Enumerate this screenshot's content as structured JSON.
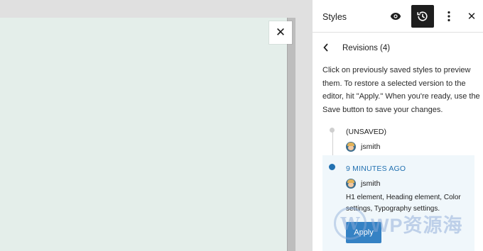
{
  "canvas": {
    "close_icon": "close-icon"
  },
  "sidebar": {
    "title": "Styles",
    "buttons": {
      "eye_icon": "eye-icon",
      "revisions_icon": "history-icon",
      "more_icon": "more-vertical-icon",
      "close_icon": "close-icon"
    }
  },
  "revisions": {
    "back_icon": "chevron-left-icon",
    "title": "Revisions (4)",
    "description": "Click on previously saved styles to preview them. To restore a selected version to the editor, hit \"Apply.\" When you're ready, use the Save button to save your changes.",
    "items": [
      {
        "label": "(UNSAVED)",
        "author": "jsmith"
      },
      {
        "label": "9 MINUTES AGO",
        "author": "jsmith",
        "changes": "H1 element, Heading element, Color settings, Typography settings.",
        "apply_label": "Apply"
      }
    ]
  },
  "watermark": {
    "logo": "W",
    "text": "WP资源海"
  },
  "colors": {
    "accent": "#2271b1",
    "apply_bg": "#3582c4",
    "canvas_bg": "#e4eeea",
    "selected_bg": "#f0f7fb"
  }
}
